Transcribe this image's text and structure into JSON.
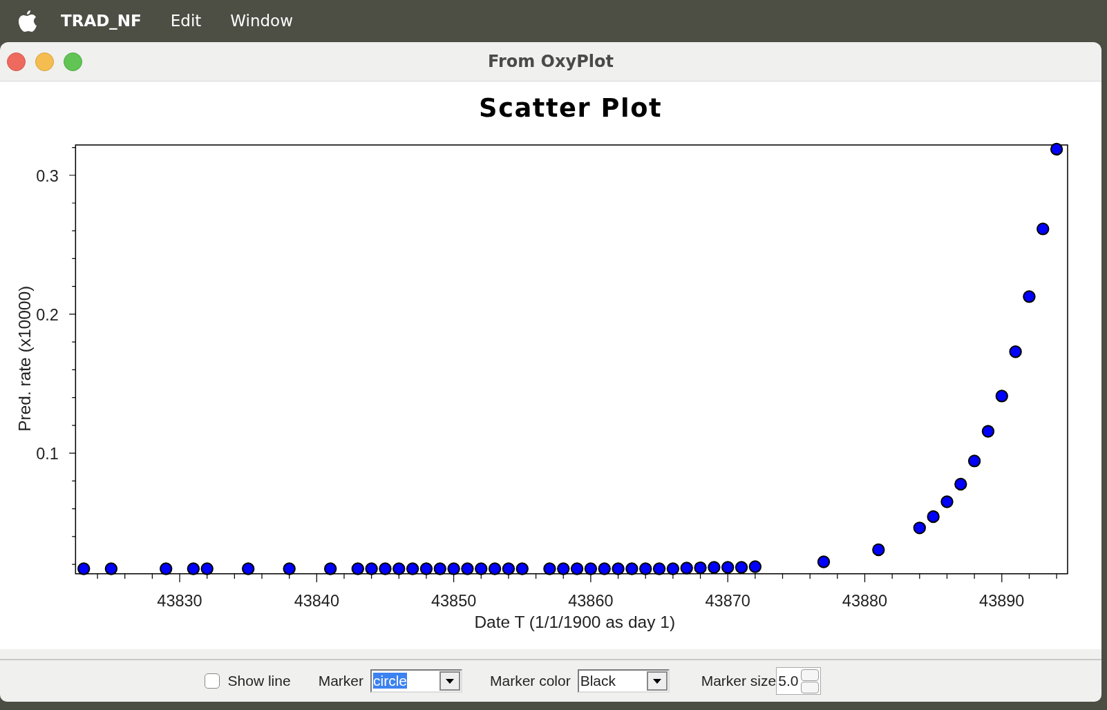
{
  "menu_bar": {
    "items": [
      {
        "label": "TRAD_NF",
        "kind": "app"
      },
      {
        "label": "Edit",
        "kind": "menu"
      },
      {
        "label": "Window",
        "kind": "menu"
      }
    ]
  },
  "window": {
    "title": "From OxyPlot"
  },
  "chart_data": {
    "type": "scatter",
    "title": "Scatter Plot",
    "xlabel": "Date T (1/1/1900 as day 1)",
    "ylabel": "Pred. rate (x10000)",
    "x": [
      43823,
      43825,
      43829,
      43831,
      43832,
      43835,
      43838,
      43841,
      43843,
      43844,
      43845,
      43846,
      43847,
      43848,
      43849,
      43850,
      43851,
      43852,
      43853,
      43854,
      43855,
      43857,
      43858,
      43859,
      43860,
      43861,
      43862,
      43863,
      43864,
      43865,
      43866,
      43867,
      43868,
      43869,
      43870,
      43871,
      43872,
      43877,
      43881,
      43884,
      43885,
      43886,
      43887,
      43888,
      43889,
      43890,
      43891,
      43892,
      43893,
      43894
    ],
    "series": [
      {
        "color": "#0000ff",
        "values": [
          0.0168,
          0.0168,
          0.0168,
          0.0168,
          0.0168,
          0.0168,
          0.0168,
          0.0168,
          0.0168,
          0.0168,
          0.0168,
          0.0168,
          0.0168,
          0.0168,
          0.0168,
          0.0168,
          0.0168,
          0.0168,
          0.0168,
          0.0168,
          0.0168,
          0.0168,
          0.0168,
          0.0168,
          0.0168,
          0.0168,
          0.0168,
          0.0168,
          0.0168,
          0.0168,
          0.0168,
          0.0173,
          0.0175,
          0.0178,
          0.0178,
          0.0178,
          0.0183,
          0.0218,
          0.0305,
          0.0462,
          0.0543,
          0.065,
          0.0777,
          0.0944,
          0.1157,
          0.1411,
          0.173,
          0.2127,
          0.2614,
          0.3188
        ]
      }
    ],
    "xlim": [
      43822.4,
      43894.8
    ],
    "ylim": [
      0.0132,
      0.3218
    ],
    "xticks": [
      43830,
      43840,
      43850,
      43860,
      43870,
      43880,
      43890
    ],
    "yticks": [
      0.1,
      0.2,
      0.3
    ]
  },
  "controls": {
    "show_line": {
      "label": "Show line",
      "checked": false
    },
    "marker": {
      "label": "Marker",
      "value": "circle",
      "text_selected": true
    },
    "marker_color": {
      "label": "Marker color",
      "value": "Black",
      "text_selected": false
    },
    "marker_size": {
      "label": "Marker size",
      "value": "5.0"
    }
  }
}
